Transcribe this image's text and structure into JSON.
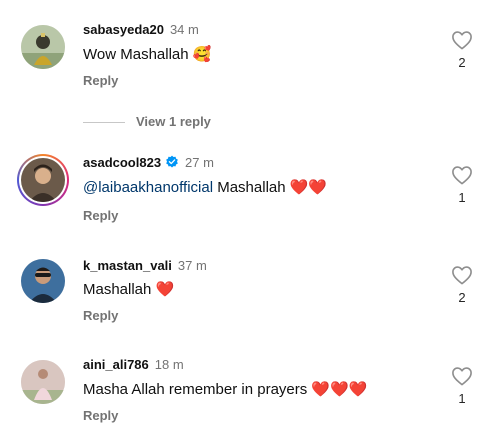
{
  "comments": [
    {
      "username": "sabasyeda20",
      "time": "34 m",
      "text": "Wow Mashallah 🥰",
      "reply_label": "Reply",
      "likes": "2",
      "verified": false,
      "story_ring": false
    },
    {
      "username": "asadcool823",
      "time": "27 m",
      "mention": "@laibaakhanofficial",
      "text": " Mashallah ❤️❤️",
      "reply_label": "Reply",
      "likes": "1",
      "verified": true,
      "story_ring": true
    },
    {
      "username": "k_mastan_vali",
      "time": "37 m",
      "text": "Mashallah ❤️",
      "reply_label": "Reply",
      "likes": "2",
      "verified": false,
      "story_ring": false
    },
    {
      "username": "aini_ali786",
      "time": "18 m",
      "text": "Masha Allah remember in prayers ❤️❤️❤️",
      "reply_label": "Reply",
      "likes": "1",
      "verified": false,
      "story_ring": false
    }
  ],
  "view_replies": "View 1 reply",
  "colors": {
    "secondary_text": "#737373",
    "mention": "#00376b",
    "verified": "#0095f6"
  },
  "icons": [
    "heart-outline-icon",
    "verified-badge-icon"
  ]
}
